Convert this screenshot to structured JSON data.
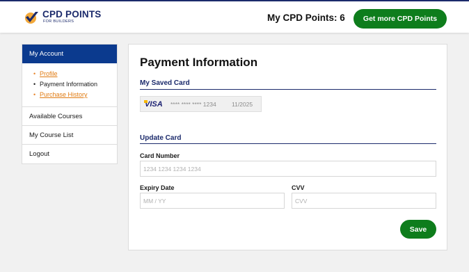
{
  "header": {
    "brand": {
      "title": "CPD POINTS",
      "subtitle": "FOR BUILDERS"
    },
    "points_label": "My CPD Points: 6",
    "get_more_label": "Get more CPD Points"
  },
  "sidebar": {
    "heading": "My Account",
    "sub_items": [
      {
        "label": "Profile",
        "state": "link"
      },
      {
        "label": "Payment Information",
        "state": "active"
      },
      {
        "label": "Purchase History",
        "state": "link"
      }
    ],
    "items": [
      {
        "label": "Available Courses"
      },
      {
        "label": "My Course List"
      },
      {
        "label": "Logout"
      }
    ]
  },
  "main": {
    "title": "Payment Information",
    "saved_section": {
      "heading": "My Saved Card",
      "card": {
        "brand": "VISA",
        "masked_number": "**** **** **** 1234",
        "expiry": "11/2025"
      }
    },
    "update_section": {
      "heading": "Update Card",
      "card_number": {
        "label": "Card Number",
        "placeholder": "1234 1234 1234 1234",
        "value": ""
      },
      "expiry": {
        "label": "Expiry Date",
        "placeholder": "MM / YY",
        "value": ""
      },
      "cvv": {
        "label": "CVV",
        "placeholder": "CVV",
        "value": ""
      }
    },
    "save_label": "Save"
  },
  "colors": {
    "brand_navy": "#1b2a6b",
    "sidebar_active": "#0b3a8e",
    "cta_green": "#0e7d1c",
    "link_orange": "#e07a10"
  }
}
